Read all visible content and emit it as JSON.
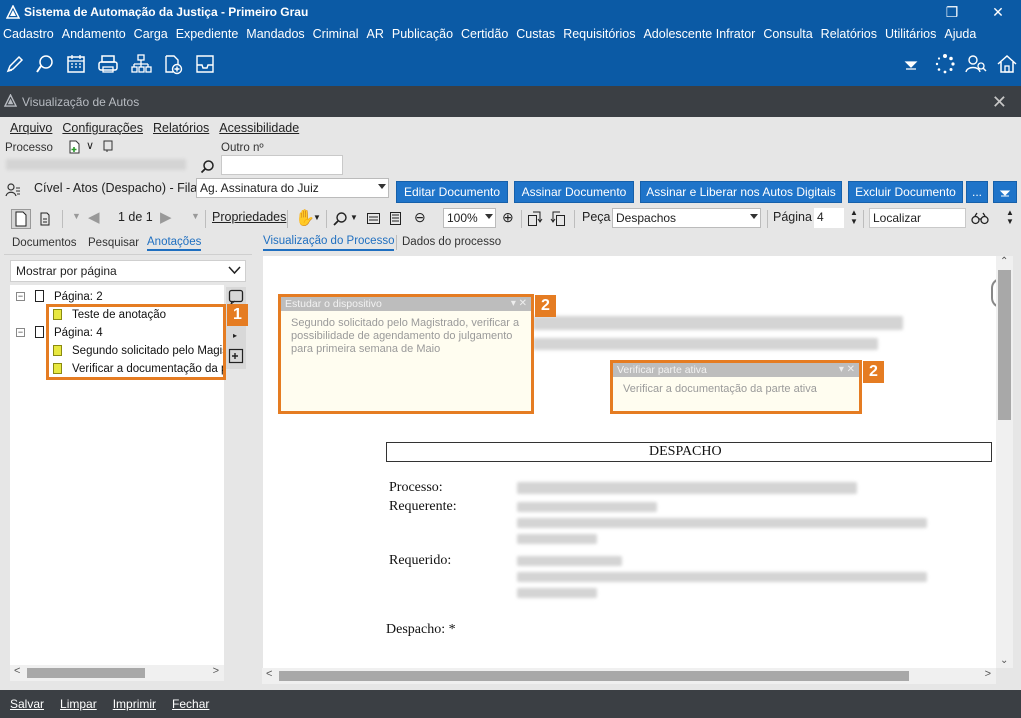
{
  "app": {
    "title": "Sistema de Automação da Justiça - Primeiro Grau",
    "window_controls": [
      "restore-icon",
      "close-icon"
    ]
  },
  "main_menu": [
    "Cadastro",
    "Andamento",
    "Carga",
    "Expediente",
    "Mandados",
    "Criminal",
    "AR",
    "Publicação",
    "Certidão",
    "Custas",
    "Requisitórios",
    "Adolescente Infrator",
    "Consulta",
    "Relatórios",
    "Utilitários",
    "Ajuda"
  ],
  "toolbar_icons": [
    "edit-icon",
    "search-balloon-icon",
    "calendar-icon",
    "print-icon",
    "org-chart-icon",
    "add-document-icon",
    "inbox-icon"
  ],
  "window": {
    "title": "Visualização de Autos"
  },
  "inner_menu": [
    "Arquivo",
    "Configurações",
    "Relatórios",
    "Acessibilidade"
  ],
  "process": {
    "label": "Processo",
    "other_label": "Outro nº",
    "queue_text": "Cível - Atos (Despacho) - Fila:",
    "queue_value": "Ag. Assinatura do Juiz"
  },
  "actions": {
    "edit": "Editar Documento",
    "sign": "Assinar Documento",
    "sign_release": "Assinar e Liberar nos Autos Digitais",
    "delete": "Excluir Documento",
    "more": "..."
  },
  "viewer_toolbar": {
    "page_indicator": "1 de 1",
    "properties": "Propriedades",
    "zoom": "100%",
    "piece_label": "Peça",
    "piece_value": "Despachos",
    "page_label": "Página",
    "page_value": "4",
    "search_placeholder": "Localizar"
  },
  "left_tabs": [
    "Documentos",
    "Pesquisar",
    "Anotações"
  ],
  "left_active_tab": "Anotações",
  "show_by": "Mostrar por página",
  "tree": {
    "page2": "Página: 2",
    "note1": "Teste de anotação",
    "page4": "Página: 4",
    "note2": "Segundo solicitado pelo Magistrado",
    "note3": "Verificar a documentação da parte ativa"
  },
  "badges": {
    "one": "1",
    "two": "2"
  },
  "right_tabs": [
    "Visualização do Processo",
    "Dados do processo"
  ],
  "right_active_tab": "Visualização do Processo",
  "stickies": [
    {
      "title": "Estudar o dispositivo",
      "body": "Segundo solicitado pelo Magistrado, verificar a possibilidade de agendamento do julgamento para primeira semana de Maio"
    },
    {
      "title": "Verificar parte ativa",
      "body": "Verificar a documentação da parte ativa"
    }
  ],
  "document": {
    "heading": "DESPACHO",
    "fields": [
      "Processo:",
      "Requerente:",
      "Requerido:",
      "Despacho: *"
    ]
  },
  "bottom_actions": [
    "Salvar",
    "Limpar",
    "Imprimir",
    "Fechar"
  ],
  "colors": {
    "title_blue": "#0b5aa5",
    "button_blue": "#1f74c9",
    "dark_bar": "#3b3f44",
    "highlight_orange": "#e57c22"
  }
}
